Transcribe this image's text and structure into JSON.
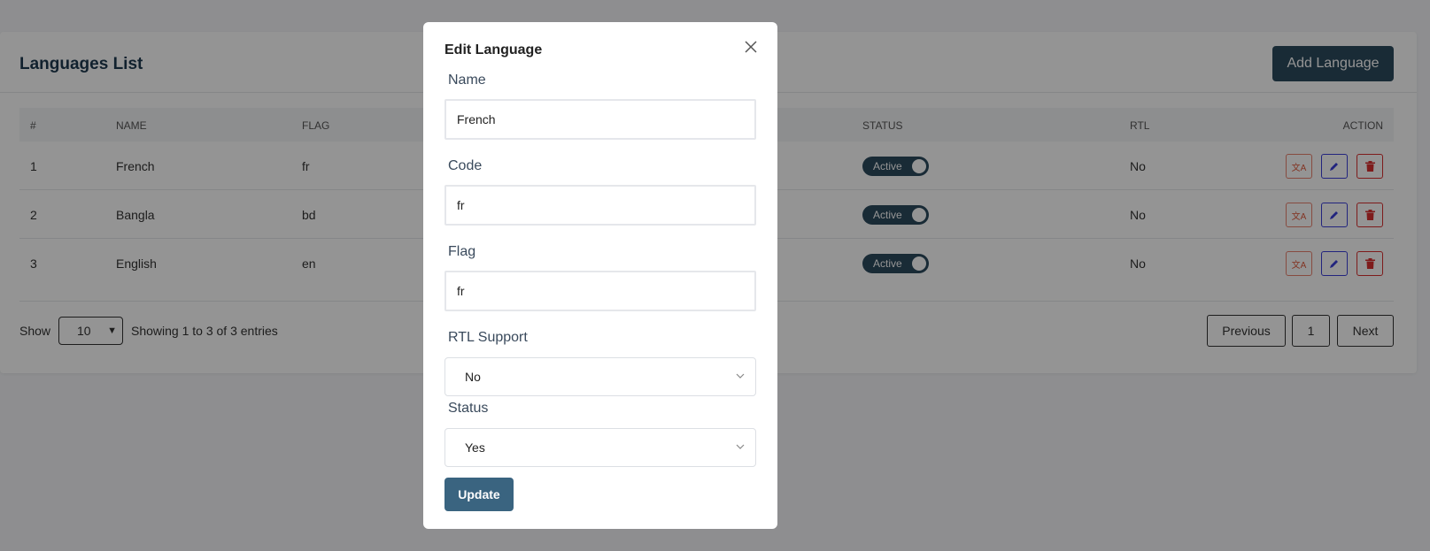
{
  "card": {
    "title": "Languages List",
    "add_button": "Add Language"
  },
  "table": {
    "headers": {
      "num": "#",
      "name": "NAME",
      "flag": "FLAG",
      "status": "STATUS",
      "rtl": "RTL",
      "action": "ACTION"
    },
    "rows": [
      {
        "num": "1",
        "name": "French",
        "flag": "fr",
        "status": "Active",
        "rtl": "No"
      },
      {
        "num": "2",
        "name": "Bangla",
        "flag": "bd",
        "status": "Active",
        "rtl": "No"
      },
      {
        "num": "3",
        "name": "English",
        "flag": "en",
        "status": "Active",
        "rtl": "No"
      }
    ]
  },
  "footer": {
    "show_label": "Show",
    "page_size": "10",
    "showing_text": "Showing 1 to 3 of 3 entries",
    "previous": "Previous",
    "page": "1",
    "next": "Next"
  },
  "modal": {
    "title": "Edit Language",
    "name_label": "Name",
    "name_value": "French",
    "code_label": "Code",
    "code_value": "fr",
    "flag_label": "Flag",
    "flag_value": "fr",
    "rtl_label": "RTL Support",
    "rtl_value": "No",
    "status_label": "Status",
    "status_value": "Yes",
    "update_button": "Update"
  },
  "colors": {
    "primary": "#2c4a5e",
    "update": "#3a6480",
    "translate_border": "#e8816f",
    "edit_border": "#3b3fd9",
    "delete_border": "#d92f2f"
  }
}
